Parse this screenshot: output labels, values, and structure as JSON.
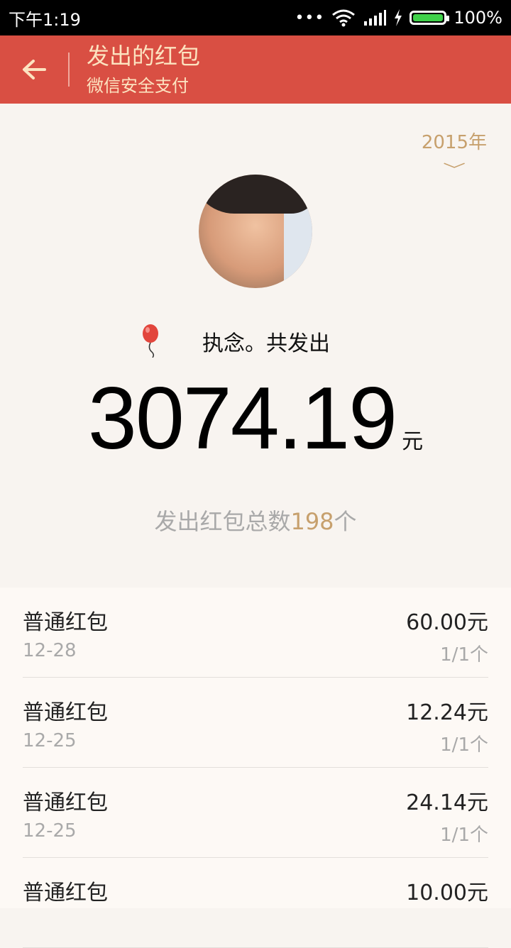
{
  "status_bar": {
    "time": "下午1:19",
    "dots": "•••",
    "battery_percent": "100%"
  },
  "app_bar": {
    "back_icon": "arrow-left-icon",
    "title": "发出的红包",
    "subtitle": "微信安全支付",
    "color": "#d94f43"
  },
  "year_selector": {
    "value": "2015年",
    "icon": "chevron-down-icon"
  },
  "summary": {
    "sender_line": "执念。共发出",
    "amount": "3074.19",
    "unit": "元",
    "count_prefix": "发出红包总数",
    "count_value": "198",
    "count_suffix": "个"
  },
  "records": [
    {
      "type": "普通红包",
      "date": "12-28",
      "amount": "60.00元",
      "count": "1/1个"
    },
    {
      "type": "普通红包",
      "date": "12-25",
      "amount": "12.24元",
      "count": "1/1个"
    },
    {
      "type": "普通红包",
      "date": "12-25",
      "amount": "24.14元",
      "count": "1/1个"
    },
    {
      "type": "普通红包",
      "date": "",
      "amount": "10.00元",
      "count": ""
    }
  ]
}
